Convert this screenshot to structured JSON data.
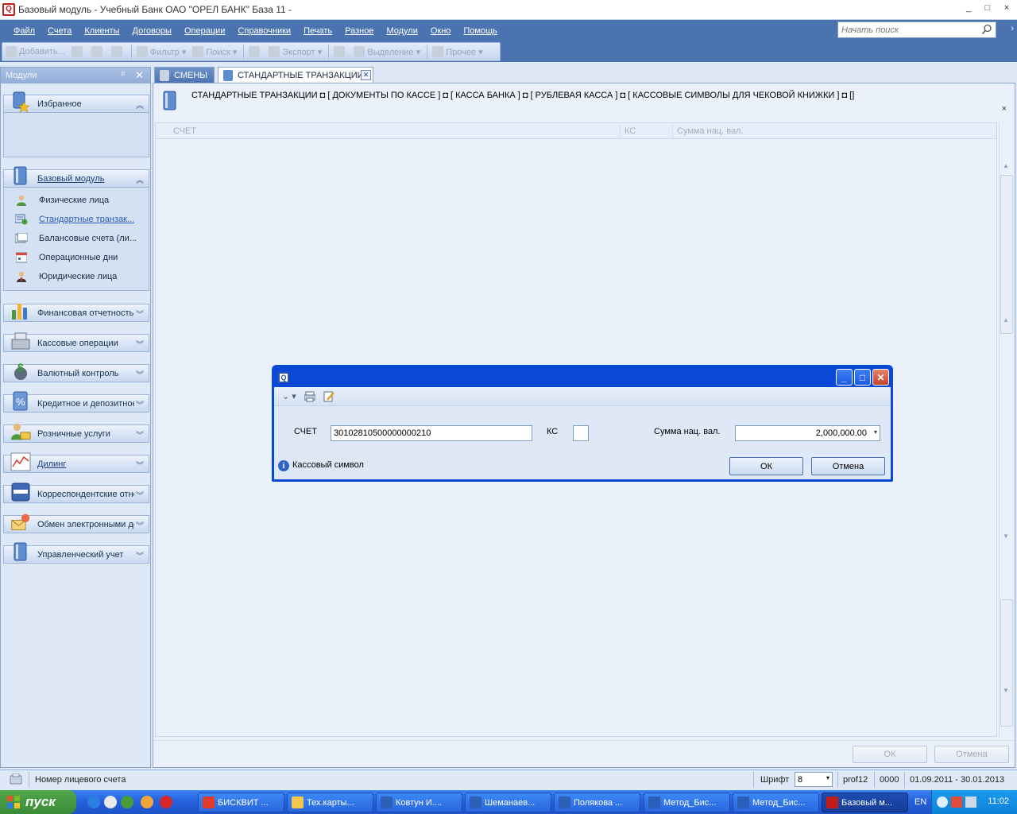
{
  "window": {
    "title": "Базовый модуль - Учебный Банк ОАО \"ОРЕЛ БАНК\" База 11 -",
    "controls": [
      "_",
      "□",
      "×"
    ]
  },
  "menu": {
    "items": [
      "Файл",
      "Счета",
      "Клиенты",
      "Договоры",
      "Операции",
      "Справочники",
      "Печать",
      "Разное",
      "Модули",
      "Окно",
      "Помощь"
    ],
    "search_placeholder": "Начать поиск",
    "more": "›"
  },
  "toolbar": {
    "items": [
      {
        "label": "Добавить...",
        "icon": "add-icon"
      },
      {
        "label": "",
        "icon": "edit-icon"
      },
      {
        "label": "",
        "icon": "view-icon"
      },
      {
        "label": "",
        "icon": "delete-icon"
      },
      {
        "label": "Фильтр ▾",
        "icon": "filter-icon"
      },
      {
        "label": "Поиск ▾",
        "icon": "binoculars-icon"
      },
      {
        "label": "",
        "icon": "print-icon"
      },
      {
        "label": "Экспорт ▾",
        "icon": "export-icon"
      },
      {
        "label": "",
        "icon": "refresh-icon"
      },
      {
        "label": "Выделение ▾",
        "icon": "select-icon"
      },
      {
        "label": "Прочее ▾",
        "icon": "other-icon"
      }
    ]
  },
  "sidebar": {
    "header": "Модули",
    "pin": "ᵖ",
    "close": "✕",
    "groups": {
      "favorites": "Избранное",
      "base": "Базовый модуль",
      "financial": "Финансовая отчетность",
      "cash": "Кассовые операции",
      "currency": "Валютный контроль",
      "credit": "Кредитное и депозитное",
      "retail": "Розничные услуги",
      "dealing": "Дилинг",
      "correspondent": "Корреспондентские отношения",
      "exchange": "Обмен электронными документами",
      "management": "Управленческий учет"
    },
    "items": [
      {
        "label": "Физические лица"
      },
      {
        "label": "Стандартные транзак..."
      },
      {
        "label": "Балансовые счета (ли..."
      },
      {
        "label": "Операционные дни"
      },
      {
        "label": "Юридические лица"
      }
    ]
  },
  "tabs": {
    "inactive": "СМЕНЫ",
    "active": "СТАНДАРТНЫЕ ТРАНЗАКЦИИ",
    "close": "✕"
  },
  "main": {
    "breadcrumb": "СТАНДАРТНЫЕ ТРАНЗАКЦИИ  ◘ [ ДОКУМЕНТЫ ПО КАССЕ ] ◘ [ КАССА БАНКА ] ◘ [ РУБЛЕВАЯ КАССА ] ◘ [ КАССОВЫЕ СИМВОЛЫ ДЛЯ ЧЕКОВОЙ КНИЖКИ ] ◘ []",
    "breadcrumb_close": "×",
    "columns": [
      "СЧЕТ",
      "КС",
      "Сумма нац. вал."
    ],
    "ok": "ОК",
    "cancel": "Отмена"
  },
  "dialog": {
    "account_label": "СЧЕТ",
    "account_value": "30102810500000000210",
    "ks_label": "КС",
    "ks_value": "",
    "amount_label": "Сумма нац. вал.",
    "amount_value": "2,000,000.00",
    "info": "Кассовый символ",
    "ok": "ОК",
    "cancel": "Отмена",
    "toolbar_chevron": "⌄ ▾"
  },
  "statusbar": {
    "text": "Номер лицевого счета",
    "font_label": "Шрифт",
    "font_value": "8",
    "user": "prof12",
    "code": "0000",
    "period": "01.09.2011 - 30.01.2013"
  },
  "taskbar": {
    "start": "пуск",
    "tasks": [
      {
        "label": "БИСКВИТ ...",
        "color": "#e23b2a"
      },
      {
        "label": "Тех.карты...",
        "color": "#f3c84b"
      },
      {
        "label": "Ковтун И....",
        "color": "#2b5fb8"
      },
      {
        "label": "Шеманаев...",
        "color": "#2b5fb8"
      },
      {
        "label": "Полякова ...",
        "color": "#2b5fb8"
      },
      {
        "label": "Метод_Бис...",
        "color": "#2b5fb8"
      },
      {
        "label": "Метод_Бис...",
        "color": "#2b5fb8"
      },
      {
        "label": "Базовый м...",
        "color": "#c21b1b"
      }
    ],
    "lang": "EN",
    "clock": "11:02"
  },
  "colors": {
    "accent": "#4b73b0",
    "dialog_frame": "#0a48d6",
    "panel_bg": "#dfe8f6"
  }
}
